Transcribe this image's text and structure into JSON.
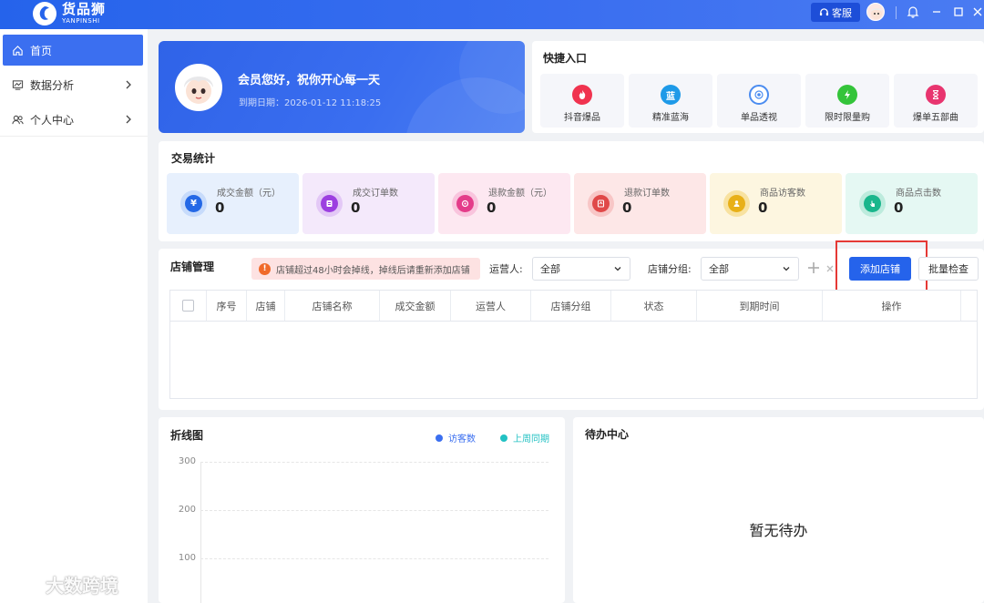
{
  "app": {
    "brand_cn": "货品狮",
    "brand_en": "YANPINSHI",
    "service_label": "客服"
  },
  "sidebar": {
    "items": [
      {
        "label": "首页",
        "icon": "home-icon",
        "active": true
      },
      {
        "label": "数据分析",
        "icon": "chart-icon",
        "active": false
      },
      {
        "label": "个人中心",
        "icon": "user-icon",
        "active": false
      }
    ]
  },
  "welcome": {
    "greeting": "会员您好，祝你开心每一天",
    "expiry": "到期日期：2026-01-12 11:18:25"
  },
  "quick": {
    "title": "快捷入口",
    "items": [
      {
        "label": "抖音爆品",
        "icon": "fire-icon",
        "color": "#f0334f"
      },
      {
        "label": "精准蓝海",
        "icon": "blue-ocean-icon",
        "glyph": "蓝",
        "color": "#1e9ae8"
      },
      {
        "label": "单品透视",
        "icon": "eye-icon",
        "color": "#4b8cf0"
      },
      {
        "label": "限时限量购",
        "icon": "lightning-icon",
        "color": "#34c43a"
      },
      {
        "label": "爆单五部曲",
        "icon": "hourglass-icon",
        "color": "#e8356f"
      }
    ]
  },
  "stats": {
    "title": "交易统计",
    "items": [
      {
        "label": "成交金额（元）",
        "value": "0",
        "icon": "yen-icon",
        "bg": "#e7f0fd",
        "ring": "#c7dbfb",
        "color": "#2468e6"
      },
      {
        "label": "成交订单数",
        "value": "0",
        "icon": "order-icon",
        "bg": "#f4e9fb",
        "ring": "#e3c8f6",
        "color": "#9c3fe0"
      },
      {
        "label": "退款金额（元）",
        "value": "0",
        "icon": "refund-icon",
        "bg": "#fde8f1",
        "ring": "#f9c4dd",
        "color": "#e43c8a"
      },
      {
        "label": "退款订单数",
        "value": "0",
        "icon": "refund-order-icon",
        "bg": "#fde7e7",
        "ring": "#f8c6c6",
        "color": "#e04848"
      },
      {
        "label": "商品访客数",
        "value": "0",
        "icon": "visitor-icon",
        "bg": "#fdf6e0",
        "ring": "#f8e2a0",
        "color": "#e8b018"
      },
      {
        "label": "商品点击数",
        "value": "0",
        "icon": "click-icon",
        "bg": "#e5f8f3",
        "ring": "#bdebdd",
        "color": "#19b68c"
      }
    ]
  },
  "shops": {
    "title": "店铺管理",
    "warning": "店铺超过48小时会掉线，掉线后请重新添加店铺",
    "operator_label": "运营人:",
    "operator_value": "全部",
    "group_label": "店铺分组:",
    "group_value": "全部",
    "add_label": "添加店铺",
    "batch_label": "批量检查",
    "columns": [
      "序号",
      "店铺",
      "店铺名称",
      "成交金额",
      "运营人",
      "店铺分组",
      "状态",
      "到期时间",
      "操作"
    ]
  },
  "line_chart": {
    "title": "折线图",
    "legend": [
      {
        "name": "访客数",
        "color": "#3b6ff0"
      },
      {
        "name": "上周同期",
        "color": "#22c1c3"
      }
    ],
    "yticks": [
      "300",
      "200",
      "100"
    ]
  },
  "todo": {
    "title": "待办中心",
    "empty": "暂无待办"
  },
  "watermark": "大数跨境"
}
